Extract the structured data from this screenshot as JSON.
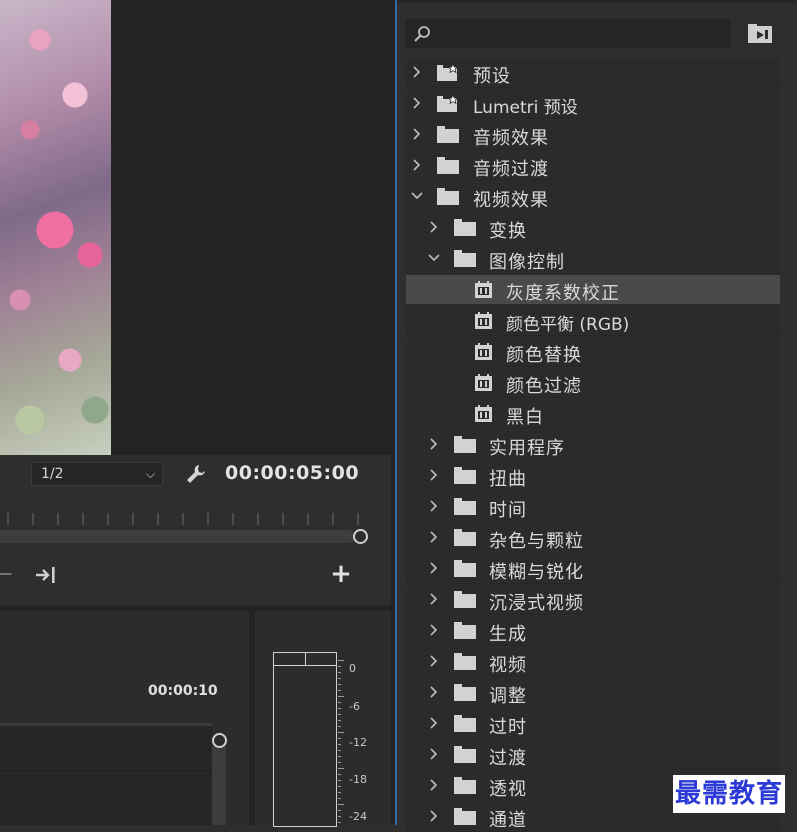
{
  "monitor": {
    "zoom_value": "1/2",
    "timecode": "00:00:05:00"
  },
  "timeline": {
    "time_label": "00:00:10"
  },
  "audio_meter": {
    "labels": [
      "0",
      "-6",
      "-12",
      "-18",
      "-24"
    ]
  },
  "effects": {
    "search_placeholder": "",
    "items": [
      {
        "label": "预设",
        "level": 0,
        "kind": "preset-folder",
        "expanded": false
      },
      {
        "label": "Lumetri 预设",
        "level": 0,
        "kind": "preset-folder",
        "expanded": false
      },
      {
        "label": "音频效果",
        "level": 0,
        "kind": "folder",
        "expanded": false
      },
      {
        "label": "音频过渡",
        "level": 0,
        "kind": "folder",
        "expanded": false
      },
      {
        "label": "视频效果",
        "level": 0,
        "kind": "folder",
        "expanded": true
      },
      {
        "label": "变换",
        "level": 1,
        "kind": "folder",
        "expanded": false
      },
      {
        "label": "图像控制",
        "level": 1,
        "kind": "folder",
        "expanded": true
      },
      {
        "label": "灰度系数校正",
        "level": 2,
        "kind": "effect",
        "selected": true
      },
      {
        "label": "颜色平衡 (RGB)",
        "level": 2,
        "kind": "effect"
      },
      {
        "label": "颜色替换",
        "level": 2,
        "kind": "effect"
      },
      {
        "label": "颜色过滤",
        "level": 2,
        "kind": "effect"
      },
      {
        "label": "黑白",
        "level": 2,
        "kind": "effect"
      },
      {
        "label": "实用程序",
        "level": 1,
        "kind": "folder",
        "expanded": false
      },
      {
        "label": "扭曲",
        "level": 1,
        "kind": "folder",
        "expanded": false
      },
      {
        "label": "时间",
        "level": 1,
        "kind": "folder",
        "expanded": false
      },
      {
        "label": "杂色与颗粒",
        "level": 1,
        "kind": "folder",
        "expanded": false
      },
      {
        "label": "模糊与锐化",
        "level": 1,
        "kind": "folder",
        "expanded": false
      },
      {
        "label": "沉浸式视频",
        "level": 1,
        "kind": "folder",
        "expanded": false
      },
      {
        "label": "生成",
        "level": 1,
        "kind": "folder",
        "expanded": false
      },
      {
        "label": "视频",
        "level": 1,
        "kind": "folder",
        "expanded": false
      },
      {
        "label": "调整",
        "level": 1,
        "kind": "folder",
        "expanded": false
      },
      {
        "label": "过时",
        "level": 1,
        "kind": "folder",
        "expanded": false
      },
      {
        "label": "过渡",
        "level": 1,
        "kind": "folder",
        "expanded": false
      },
      {
        "label": "透视",
        "level": 1,
        "kind": "folder",
        "expanded": false
      },
      {
        "label": "通道",
        "level": 1,
        "kind": "folder",
        "expanded": false
      }
    ]
  },
  "watermark": "最需教育",
  "colors": {
    "panel_bg": "#2e2e2e",
    "row_bg": "#2b2b2b",
    "selected_row": "#4a4a4a",
    "focus_border": "#2f6ca3",
    "text": "#d9d9d9",
    "watermark": "#2b3ad6"
  }
}
